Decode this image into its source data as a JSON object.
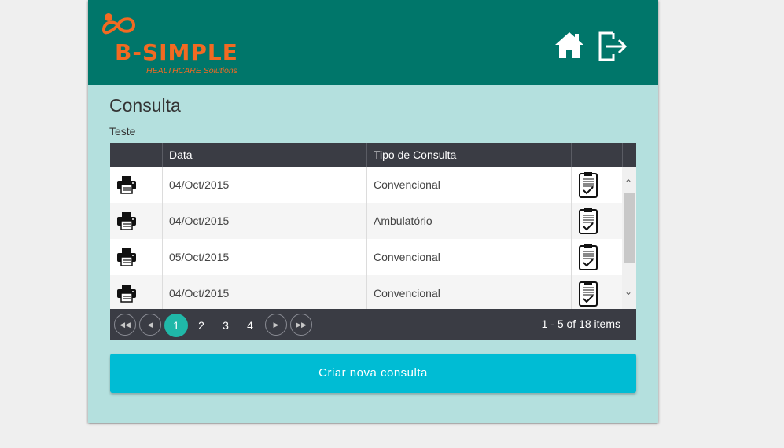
{
  "brand": {
    "name": "B-SIMPLE",
    "tagline": "HEALTHCARE Solutions",
    "color": "#f26a22"
  },
  "header": {
    "background": "#00766a",
    "icons": [
      "home-icon",
      "logout-icon"
    ]
  },
  "page": {
    "title": "Consulta",
    "subtitle": "Teste"
  },
  "grid": {
    "columns": [
      "",
      "Data",
      "Tipo de Consulta",
      ""
    ],
    "rows": [
      {
        "date": "04/Oct/2015",
        "type": "Convencional"
      },
      {
        "date": "04/Oct/2015",
        "type": "Ambulatório"
      },
      {
        "date": "05/Oct/2015",
        "type": "Convencional"
      },
      {
        "date": "04/Oct/2015",
        "type": "Convencional"
      }
    ]
  },
  "pager": {
    "pages": [
      "1",
      "2",
      "3",
      "4"
    ],
    "current": "1",
    "info": "1 - 5 of 18 items"
  },
  "actions": {
    "create": "Criar nova consulta"
  }
}
